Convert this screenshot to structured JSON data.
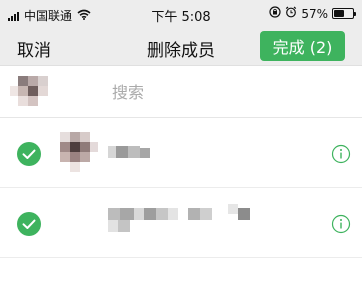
{
  "status_bar": {
    "carrier": "中国联通",
    "time": "下午 5:08",
    "battery_text": "57%",
    "battery_level": 0.57,
    "icons": [
      "signal-icon",
      "wifi-icon",
      "orientation-lock-icon",
      "alarm-icon",
      "battery-icon"
    ]
  },
  "nav": {
    "cancel_label": "取消",
    "title": "删除成员",
    "done_label": "完成 (2)"
  },
  "search": {
    "placeholder": "搜索"
  },
  "members": [
    {
      "selected": true,
      "icons": [
        "check-icon",
        "info-icon"
      ]
    },
    {
      "selected": true,
      "icons": [
        "check-icon",
        "info-icon"
      ]
    }
  ],
  "colors": {
    "accent": "#3eb35e",
    "nav_background": "#ededed",
    "info_icon": "#3eb35e"
  }
}
